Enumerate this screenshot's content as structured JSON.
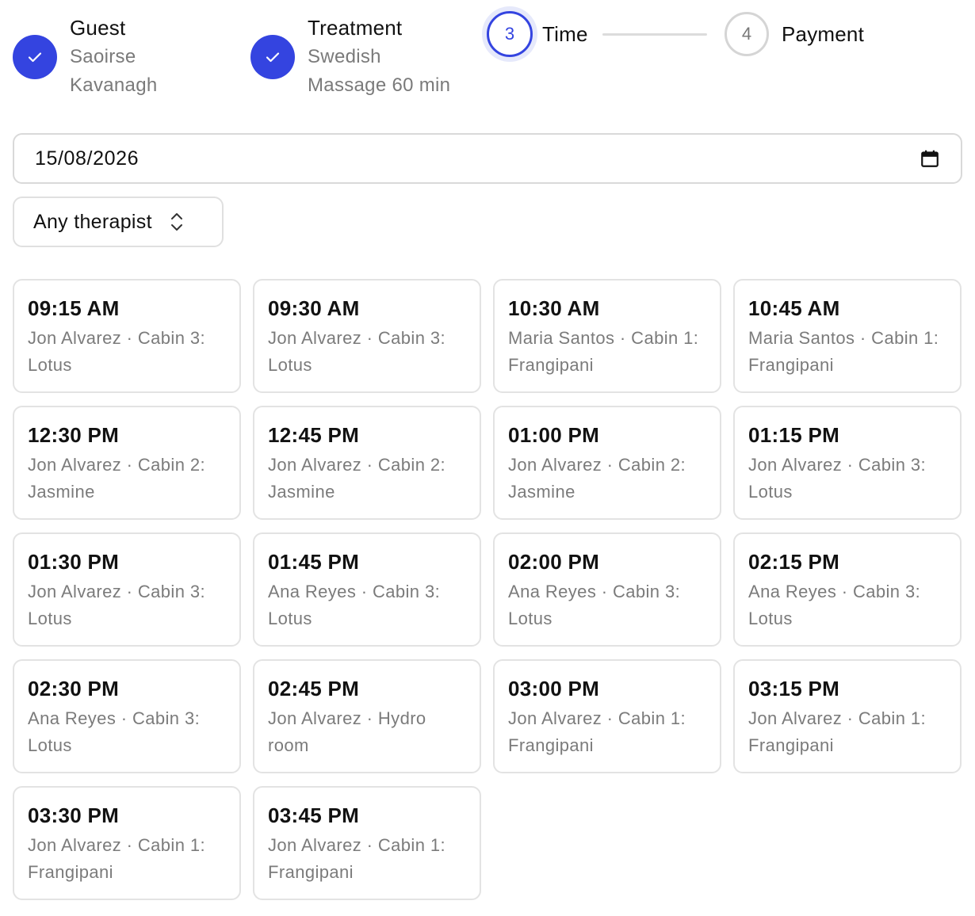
{
  "stepper": {
    "steps": [
      {
        "title": "Guest",
        "line1": "Saoirse",
        "line2": "Kavanagh",
        "status": "done"
      },
      {
        "title": "Treatment",
        "line1": "Swedish",
        "line2": "Massage 60 min",
        "status": "done"
      },
      {
        "number": "3",
        "title": "Time",
        "status": "current"
      },
      {
        "number": "4",
        "title": "Payment",
        "status": "upcoming"
      }
    ]
  },
  "date_field": {
    "value": "15/08/2026",
    "icon": "calendar-icon"
  },
  "therapist_select": {
    "selected": "Any therapist",
    "icon": "updown-chevron-icon"
  },
  "slots": [
    {
      "time": "09:15 AM",
      "detail": "Jon Alvarez · Cabin 3: Lotus"
    },
    {
      "time": "09:30 AM",
      "detail": "Jon Alvarez · Cabin 3: Lotus"
    },
    {
      "time": "10:30 AM",
      "detail": "Maria Santos · Cabin 1: Frangipani"
    },
    {
      "time": "10:45 AM",
      "detail": "Maria Santos · Cabin 1: Frangipani"
    },
    {
      "time": "12:30 PM",
      "detail": "Jon Alvarez · Cabin 2: Jasmine"
    },
    {
      "time": "12:45 PM",
      "detail": "Jon Alvarez · Cabin 2: Jasmine"
    },
    {
      "time": "01:00 PM",
      "detail": "Jon Alvarez · Cabin 2: Jasmine"
    },
    {
      "time": "01:15 PM",
      "detail": "Jon Alvarez · Cabin 3: Lotus"
    },
    {
      "time": "01:30 PM",
      "detail": "Jon Alvarez · Cabin 3: Lotus"
    },
    {
      "time": "01:45 PM",
      "detail": "Ana Reyes · Cabin 3: Lotus"
    },
    {
      "time": "02:00 PM",
      "detail": "Ana Reyes · Cabin 3: Lotus"
    },
    {
      "time": "02:15 PM",
      "detail": "Ana Reyes · Cabin 3: Lotus"
    },
    {
      "time": "02:30 PM",
      "detail": "Ana Reyes · Cabin 3: Lotus"
    },
    {
      "time": "02:45 PM",
      "detail": "Jon Alvarez · Hydro room"
    },
    {
      "time": "03:00 PM",
      "detail": "Jon Alvarez · Cabin 1: Frangipani"
    },
    {
      "time": "03:15 PM",
      "detail": "Jon Alvarez · Cabin 1: Frangipani"
    },
    {
      "time": "03:30 PM",
      "detail": "Jon Alvarez · Cabin 1: Frangipani"
    },
    {
      "time": "03:45 PM",
      "detail": "Jon Alvarez · Cabin 1: Frangipani"
    }
  ],
  "colors": {
    "accent": "#3444e0",
    "muted_text": "#7a7a7a",
    "border": "#e0e0e0"
  }
}
